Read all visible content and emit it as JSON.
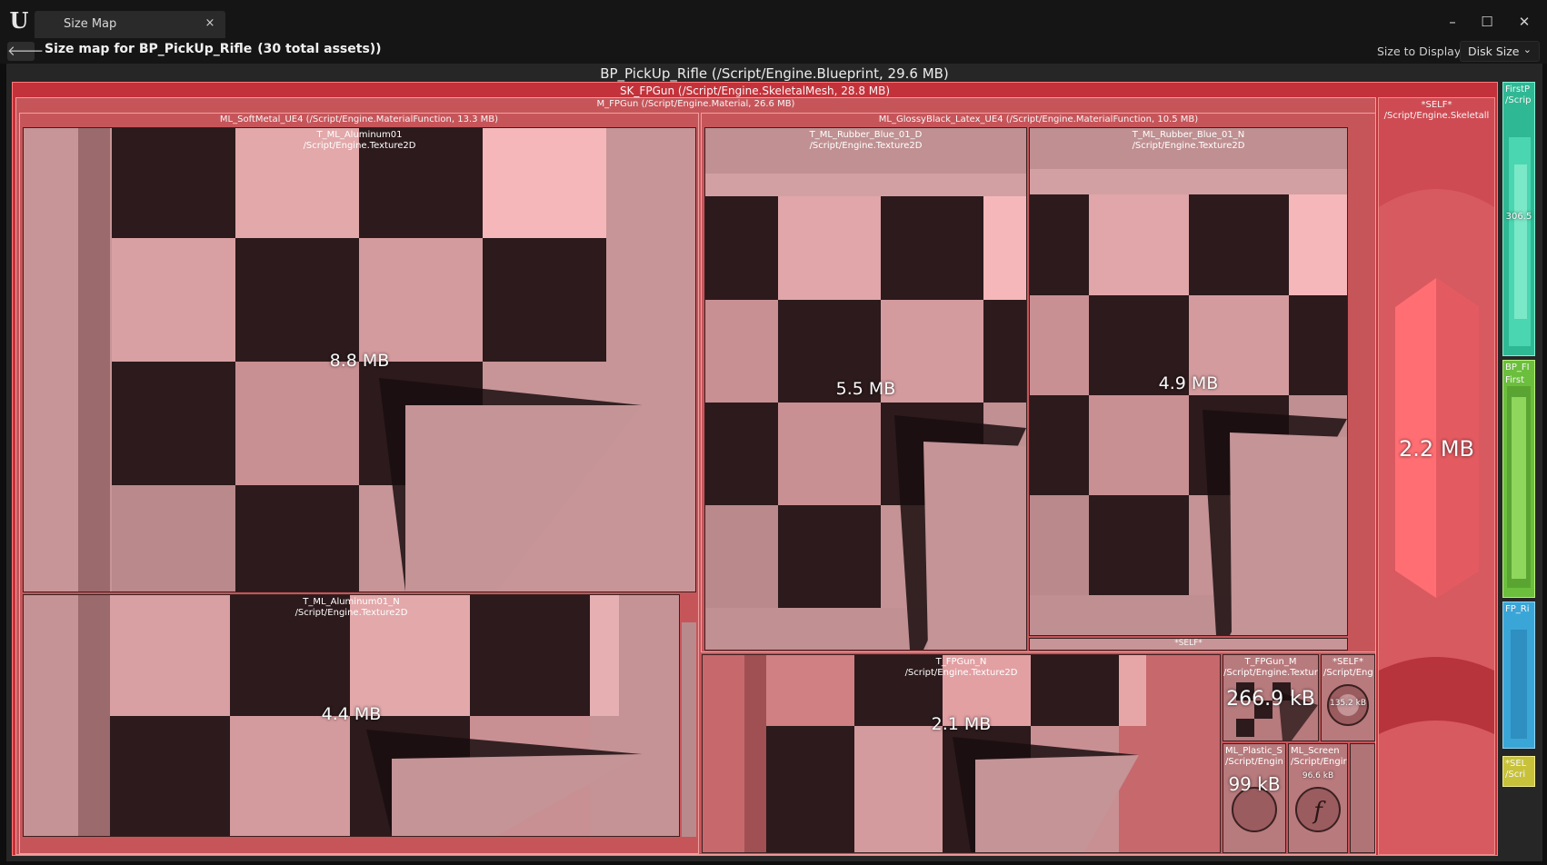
{
  "window": {
    "tab_label": "Size Map",
    "tab_close": "×",
    "minimize": "–",
    "maximize": "☐",
    "close": "✕",
    "logo": "U"
  },
  "toolbar": {
    "back_icon": "🡐",
    "heading": "Size map for BP_PickUp_Rifle",
    "heading_total": "(30 total assets))",
    "size_to_display_label": "Size to Display:",
    "size_to_display_value": "Disk Size",
    "chevron": "⌄"
  },
  "map": {
    "root_title": "BP_PickUp_Rifle  (/Script/Engine.Blueprint, 29.6 MB)",
    "skeletal_mesh": "SK_FPGun  (/Script/Engine.SkeletalMesh, 28.8 MB)",
    "material": "M_FPGun  (/Script/Engine.Material, 26.6 MB)",
    "mf_softmetal": "ML_SoftMetal_UE4  (/Script/Engine.MaterialFunction, 13.3 MB)",
    "mf_glossyblack": "ML_GlossyBlack_Latex_UE4  (/Script/Engine.MaterialFunction, 10.5 MB)",
    "aluminum01": {
      "name": "T_ML_Aluminum01",
      "type": "/Script/Engine.Texture2D",
      "size": "8.8 MB"
    },
    "aluminum01_n": {
      "name": "T_ML_Aluminum01_N",
      "type": "/Script/Engine.Texture2D",
      "size": "4.4 MB"
    },
    "rubber_d": {
      "name": "T_ML_Rubber_Blue_01_D",
      "type": "/Script/Engine.Texture2D",
      "size": "5.5 MB"
    },
    "rubber_n": {
      "name": "T_ML_Rubber_Blue_01_N",
      "type": "/Script/Engine.Texture2D",
      "size": "4.9 MB"
    },
    "rubber_self": "*SELF*",
    "fpgun_n": {
      "name": "T_FPGun_N",
      "type": "/Script/Engine.Texture2D",
      "size": "2.1 MB"
    },
    "fpgun_m": {
      "name": "T_FPGun_M",
      "type": "/Script/Engine.Texture",
      "size": "266.9 kB"
    },
    "mat_self": {
      "name": "*SELF*",
      "type": "/Script/Eng",
      "size": "135.2 kB"
    },
    "ml_plastic": {
      "name": "ML_Plastic_S",
      "type": "/Script/Engin",
      "size": "99 kB"
    },
    "ml_screen": {
      "name": "ML_Screen",
      "type": "/Script/Engir",
      "size": "96.6 kB"
    },
    "mesh_self": {
      "name": "*SELF*",
      "type": "/Script/Engine.Skeletall",
      "size": "2.2 MB"
    },
    "side_firstp": {
      "name": "FirstP",
      "type": "/Scrip",
      "size": "306.5"
    },
    "side_bpfi": {
      "name": "BP_FI",
      "sub": "First"
    },
    "side_fpri": {
      "name": "FP_Ri"
    },
    "side_self": {
      "name": "*SEL",
      "type": "/Scri"
    }
  },
  "colors": {
    "red": "#c3323a",
    "rose": "#c6555a",
    "teal": "#30c0a0",
    "green": "#7cc84a",
    "blue": "#3aa6d8",
    "yellow": "#c7c23a"
  }
}
